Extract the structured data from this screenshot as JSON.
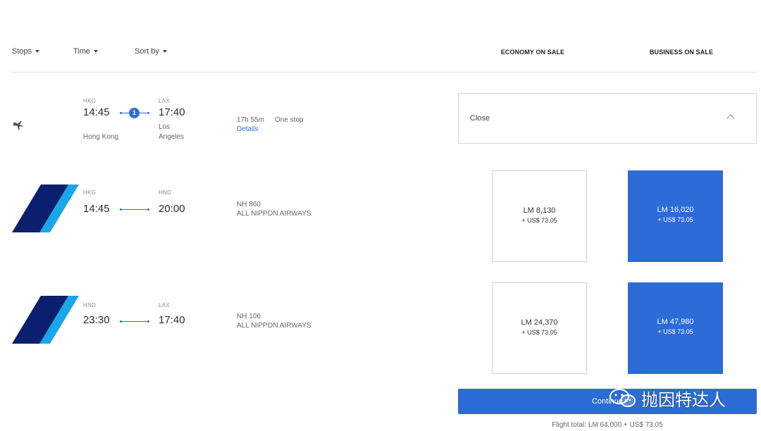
{
  "filters": {
    "stops": "Stops",
    "time": "Time",
    "sort_by": "Sort by"
  },
  "columns": {
    "economy": "ECONOMY ON SALE",
    "business": "BUSINESS ON SALE"
  },
  "itinerary": {
    "origin_code": "HKG",
    "origin_time": "14:45",
    "origin_city": "Hong Kong",
    "dest_code": "LAX",
    "dest_time": "17:40",
    "dest_city_1": "Los",
    "dest_city_2": "Angeles",
    "stops_count": "1",
    "duration": "17h 55m",
    "stops_label": "One stop",
    "details_link": "Details"
  },
  "close_panel": {
    "label": "Close"
  },
  "segments": [
    {
      "origin_code": "HKG",
      "origin_time": "14:45",
      "dest_code": "HND",
      "dest_time": "20:00",
      "flight_no": "NH 860",
      "airline": "ALL NIPPON AIRWAYS",
      "economy": {
        "points": "LM 8,130",
        "tax": "+ US$ 73.05"
      },
      "business": {
        "points": "LM 16,020",
        "tax": "+ US$ 73.05"
      }
    },
    {
      "origin_code": "HND",
      "origin_time": "23:30",
      "dest_code": "LAX",
      "dest_time": "17:40",
      "flight_no": "NH 106",
      "airline": "ALL NIPPON AIRWAYS",
      "economy": {
        "points": "LM 24,370",
        "tax": "+ US$ 73.05"
      },
      "business": {
        "points": "LM 47,980",
        "tax": "+ US$ 73.05"
      }
    }
  ],
  "continue_button": "Continue",
  "flight_total": "Flight total: LM 64,000 + US$ 73.05",
  "watermark": "抛因特达人",
  "icons": {
    "plane": "plane-icon",
    "airline_logo": "ana-logo-icon",
    "chevron": "chevron-up-icon",
    "caret": "caret-down-icon"
  },
  "colors": {
    "accent": "#2d6bd6",
    "ana_navy": "#0a1f6e",
    "ana_light": "#1aa6e8"
  }
}
